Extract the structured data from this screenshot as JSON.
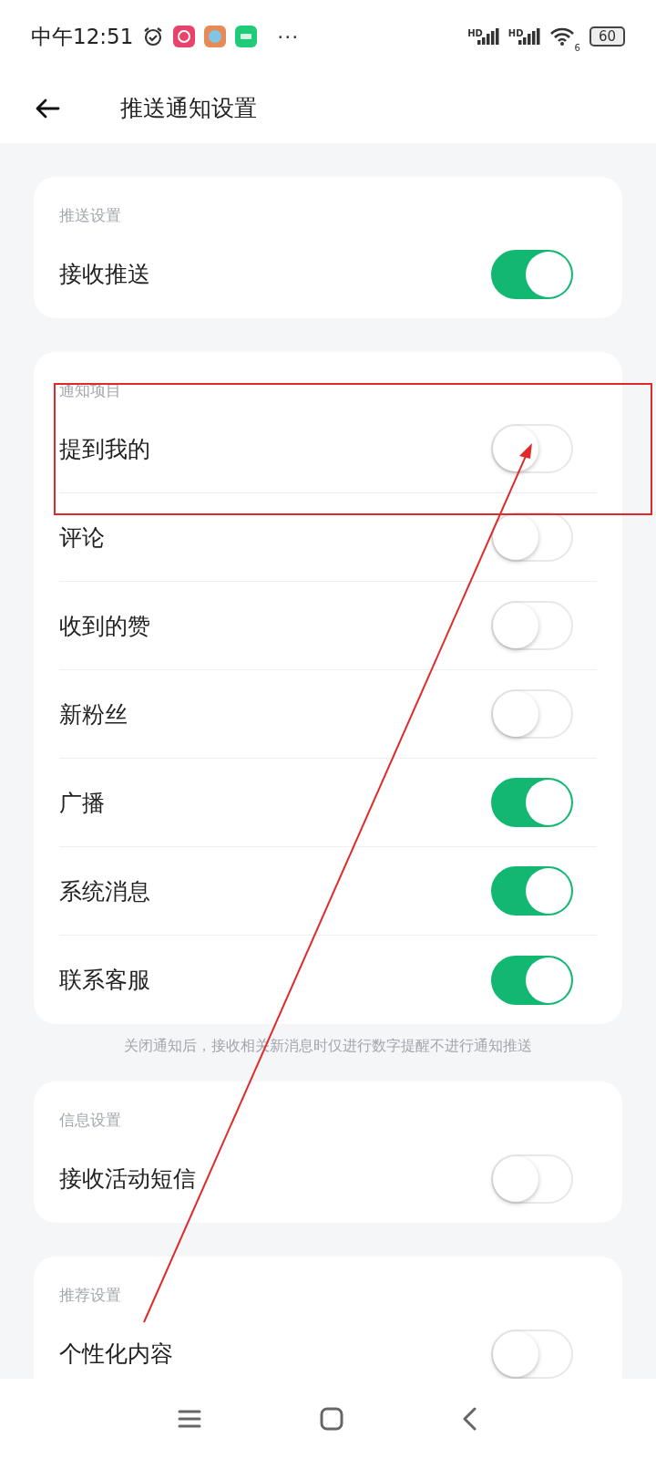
{
  "status_bar": {
    "time": "中午12:51",
    "more": "···",
    "signals": [
      {
        "label": "HD"
      },
      {
        "label": "HD"
      }
    ],
    "wifi_label": "6",
    "battery": "60"
  },
  "header": {
    "title": "推送通知设置"
  },
  "sections": [
    {
      "title": "推送设置",
      "rows": [
        {
          "label": "接收推送",
          "on": true
        }
      ]
    },
    {
      "title": "通知项目",
      "rows": [
        {
          "label": "提到我的",
          "on": false
        },
        {
          "label": "评论",
          "on": false
        },
        {
          "label": "收到的赞",
          "on": false
        },
        {
          "label": "新粉丝",
          "on": false
        },
        {
          "label": "广播",
          "on": true
        },
        {
          "label": "系统消息",
          "on": true
        },
        {
          "label": "联系客服",
          "on": true
        }
      ],
      "note": "关闭通知后，接收相关新消息时仅进行数字提醒不进行通知推送"
    },
    {
      "title": "信息设置",
      "rows": [
        {
          "label": "接收活动短信",
          "on": false
        }
      ]
    },
    {
      "title": "推荐设置",
      "rows": [
        {
          "label": "个性化内容",
          "on": false
        }
      ]
    }
  ]
}
